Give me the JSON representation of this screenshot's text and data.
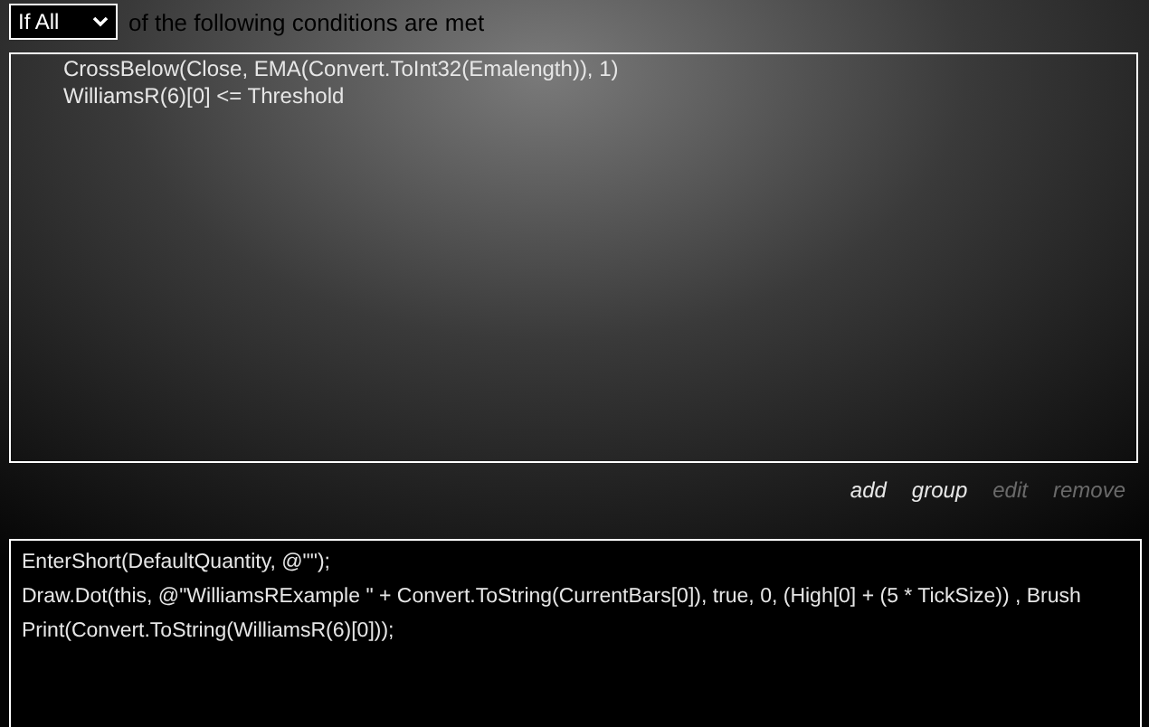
{
  "match_select": {
    "value": "If All"
  },
  "match_label": "of the following conditions are met",
  "conditions": [
    {
      "text": "CrossBelow(Close, EMA(Convert.ToInt32(Emalength)), 1)"
    },
    {
      "text": "WilliamsR(6)[0] <= Threshold"
    }
  ],
  "condition_actions": [
    {
      "label": "add",
      "disabled": false
    },
    {
      "label": "group",
      "disabled": false
    },
    {
      "label": "edit",
      "disabled": true
    },
    {
      "label": "remove",
      "disabled": true
    }
  ],
  "actions": [
    "EnterShort(DefaultQuantity, @\"\");",
    "Draw.Dot(this, @\"WilliamsRExample \" + Convert.ToString(CurrentBars[0]), true, 0, (High[0] + (5 * TickSize)) , Brush",
    "Print(Convert.ToString(WilliamsR(6)[0]));"
  ]
}
